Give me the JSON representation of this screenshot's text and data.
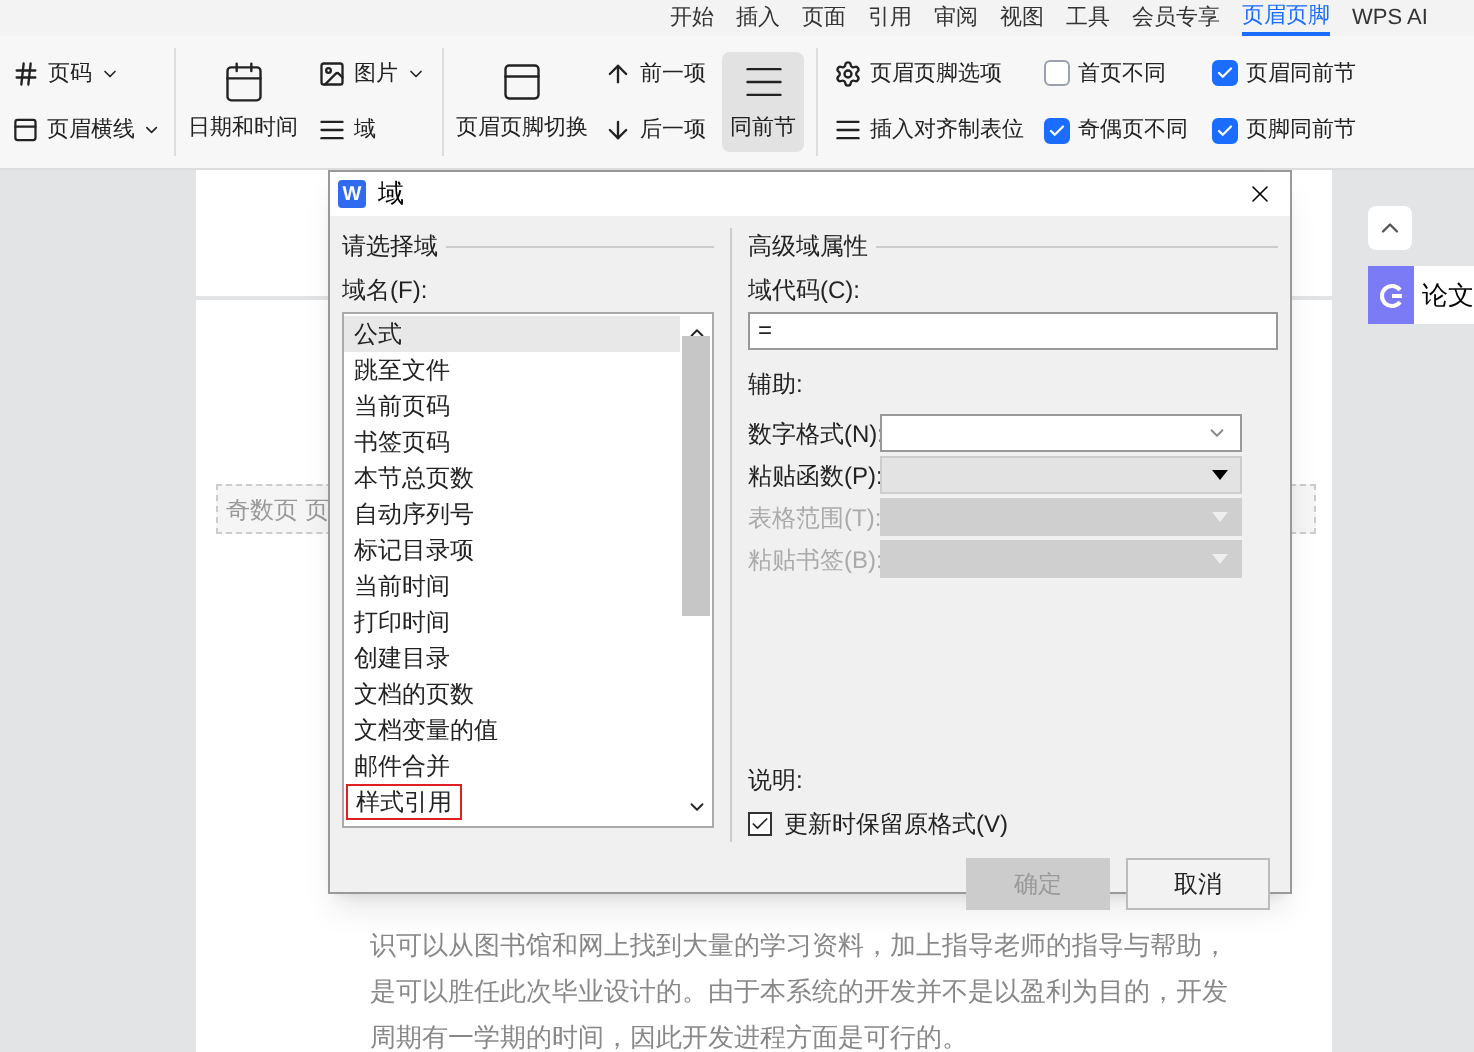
{
  "menu_tabs": [
    {
      "label": "开始",
      "selected": false
    },
    {
      "label": "插入",
      "selected": false
    },
    {
      "label": "页面",
      "selected": false
    },
    {
      "label": "引用",
      "selected": false
    },
    {
      "label": "审阅",
      "selected": false
    },
    {
      "label": "视图",
      "selected": false
    },
    {
      "label": "工具",
      "selected": false
    },
    {
      "label": "会员专享",
      "selected": false
    },
    {
      "label": "页眉页脚",
      "selected": true
    },
    {
      "label": "WPS AI",
      "selected": false
    }
  ],
  "ribbon": {
    "page_number": "页码",
    "header_line": "页眉横线",
    "date_time": "日期和时间",
    "picture": "图片",
    "field": "域",
    "switch": "页眉页脚切换",
    "previous": "前一项",
    "next": "后一项",
    "same_as_previous": {
      "label": "同前节",
      "selected": true
    },
    "options": "页眉页脚选项",
    "insert_tab": "插入对齐制表位",
    "checkboxes": [
      {
        "label": "首页不同",
        "checked": false
      },
      {
        "label": "页眉同前节",
        "checked": true
      },
      {
        "label": "奇偶页不同",
        "checked": true
      },
      {
        "label": "页脚同前节",
        "checked": true
      }
    ]
  },
  "document": {
    "header_label": "奇数页 页",
    "side_panel": "论文",
    "lines": [
      "识可以从图书馆和网上找到大量的学习资料，加上指导老师的指导与帮助，",
      "是可以胜任此次毕业设计的。由于本系统的开发并不是以盈利为目的，开发",
      "周期有一学期的时间，因此开发进程方面是可行的。"
    ]
  },
  "dialog": {
    "app_logo": "W",
    "title": "域",
    "left_group": "请选择域",
    "list_label": "域名(F):",
    "fields": [
      {
        "label": "公式",
        "selected": true,
        "highlighted": false
      },
      {
        "label": "跳至文件",
        "selected": false,
        "highlighted": false
      },
      {
        "label": "当前页码",
        "selected": false,
        "highlighted": false
      },
      {
        "label": "书签页码",
        "selected": false,
        "highlighted": false
      },
      {
        "label": "本节总页数",
        "selected": false,
        "highlighted": false
      },
      {
        "label": "自动序列号",
        "selected": false,
        "highlighted": false
      },
      {
        "label": "标记目录项",
        "selected": false,
        "highlighted": false
      },
      {
        "label": "当前时间",
        "selected": false,
        "highlighted": false
      },
      {
        "label": "打印时间",
        "selected": false,
        "highlighted": false
      },
      {
        "label": "创建目录",
        "selected": false,
        "highlighted": false
      },
      {
        "label": "文档的页数",
        "selected": false,
        "highlighted": false
      },
      {
        "label": "文档变量的值",
        "selected": false,
        "highlighted": false
      },
      {
        "label": "邮件合并",
        "selected": false,
        "highlighted": false
      },
      {
        "label": "样式引用",
        "selected": false,
        "highlighted": true
      }
    ],
    "right_group": "高级域属性",
    "code_label": "域代码(C):",
    "code_value": "=",
    "helper_label": "辅助:",
    "helpers": [
      {
        "label": "数字格式(N):",
        "disabled": false,
        "kind": "combo"
      },
      {
        "label": "粘贴函数(P):",
        "disabled": false,
        "kind": "list"
      },
      {
        "label": "表格范围(T):",
        "disabled": true,
        "kind": "list"
      },
      {
        "label": "粘贴书签(B):",
        "disabled": true,
        "kind": "list"
      }
    ],
    "description_label": "说明:",
    "keep_format": {
      "label": "更新时保留原格式(V)",
      "checked": true
    },
    "buttons": [
      {
        "label": "确定",
        "disabled": true
      },
      {
        "label": "取消",
        "disabled": false
      }
    ]
  }
}
